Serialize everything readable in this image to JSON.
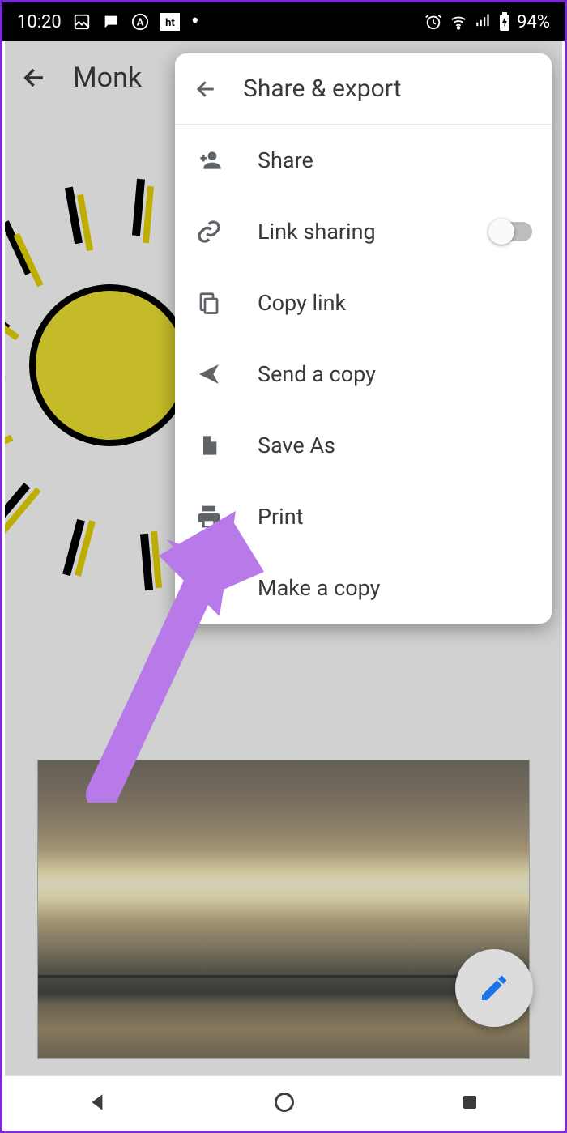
{
  "status": {
    "time": "10:20",
    "battery": "94%"
  },
  "app": {
    "back_icon": "back",
    "title": "Monk"
  },
  "popup": {
    "title": "Share & export",
    "items": [
      {
        "icon": "person-add",
        "label": "Share"
      },
      {
        "icon": "link",
        "label": "Link sharing",
        "toggle": false
      },
      {
        "icon": "copy",
        "label": "Copy link"
      },
      {
        "icon": "send",
        "label": "Send a copy"
      },
      {
        "icon": "file",
        "label": "Save As"
      },
      {
        "icon": "print",
        "label": "Print"
      },
      {
        "icon": "copy-file",
        "label": "Make a copy"
      }
    ]
  },
  "fab": {
    "icon": "edit"
  }
}
